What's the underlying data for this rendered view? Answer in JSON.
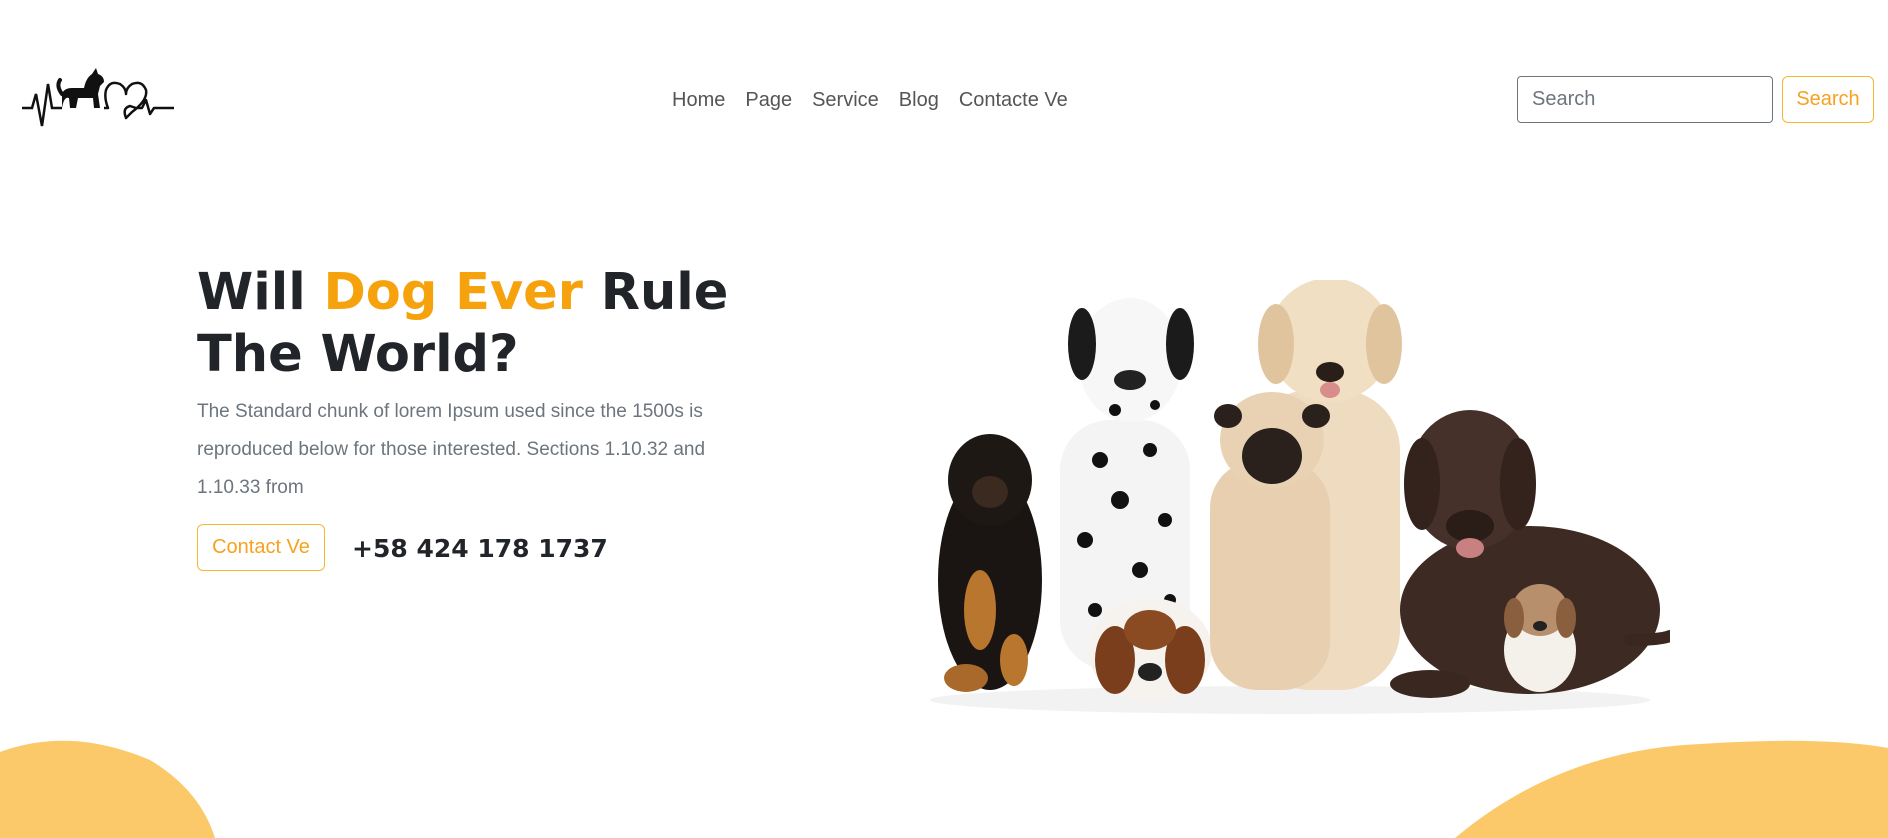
{
  "nav": {
    "logo_alt": "heartbeat-dog-logo",
    "links": [
      {
        "label": "Home"
      },
      {
        "label": "Page"
      },
      {
        "label": "Service"
      },
      {
        "label": "Blog"
      },
      {
        "label": "Contacte Ve"
      }
    ],
    "search": {
      "placeholder": "Search",
      "value": "",
      "button_label": "Search"
    }
  },
  "hero": {
    "title_part1": "Will ",
    "title_accent": "Dog Ever",
    "title_part2": " Rule The World?",
    "description": "The Standard chunk of lorem Ipsum used since the 1500s is reproduced below for those interested. Sections 1.10.32 and 1.10.33 from",
    "contact_button_label": "Contact Ve",
    "phone": "+58 424 178 1737"
  },
  "colors": {
    "accent": "#f5a20c",
    "button_border": "#f7b731",
    "wave": "#fcc96a",
    "heading": "#212529",
    "text_muted": "#6c757d"
  }
}
